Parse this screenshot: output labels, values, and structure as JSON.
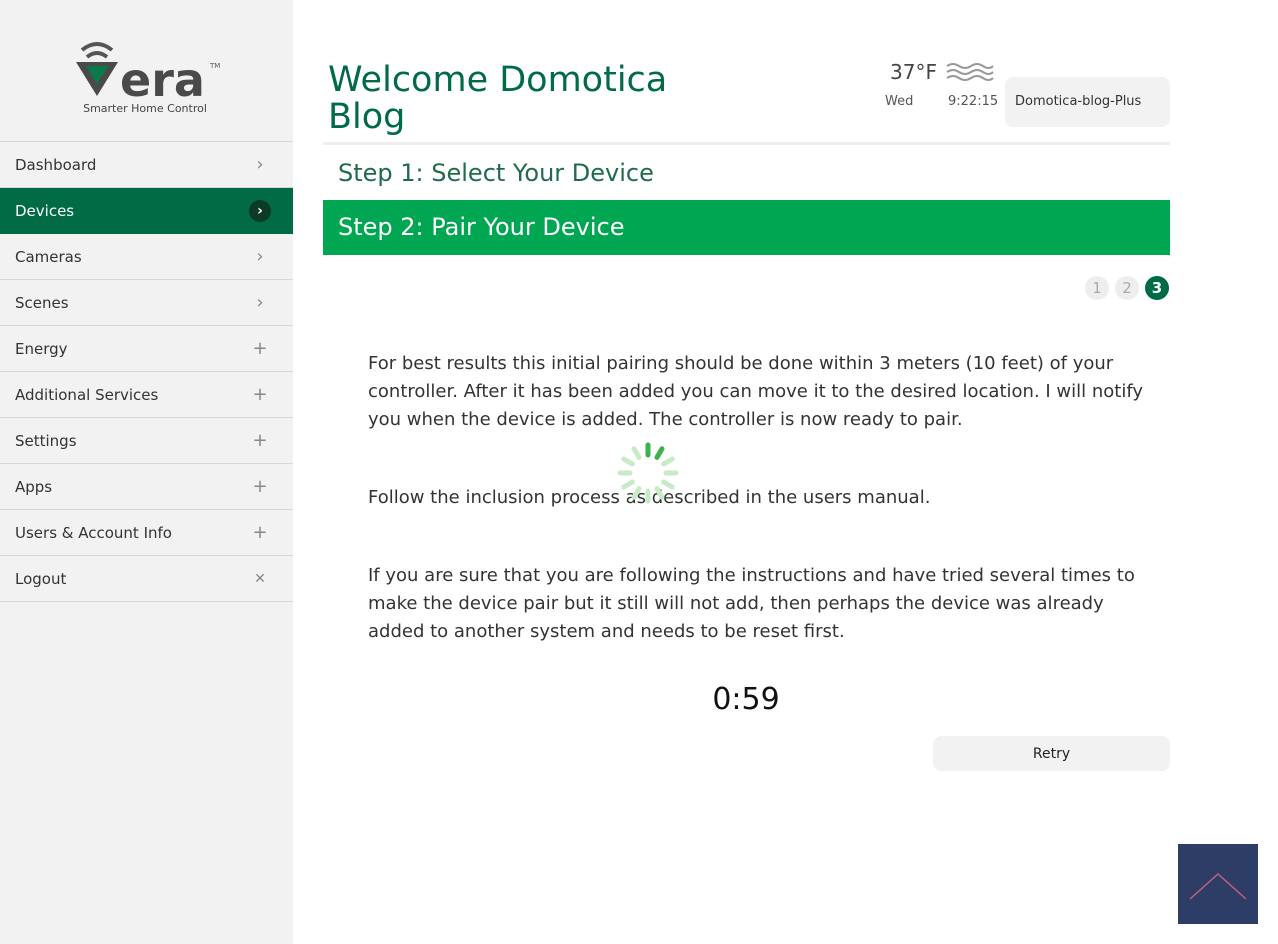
{
  "brand": {
    "logo_text": "vera",
    "tagline": "Smarter Home Control"
  },
  "sidebar": {
    "items": [
      {
        "label": "Dashboard",
        "icon": "chevron-right-icon",
        "glyph": "›"
      },
      {
        "label": "Devices",
        "icon": "chevron-right-icon",
        "glyph": "›"
      },
      {
        "label": "Cameras",
        "icon": "chevron-right-icon",
        "glyph": "›"
      },
      {
        "label": "Scenes",
        "icon": "chevron-right-icon",
        "glyph": "›"
      },
      {
        "label": "Energy",
        "icon": "plus-icon",
        "glyph": "+"
      },
      {
        "label": "Additional Services",
        "icon": "plus-icon",
        "glyph": "+"
      },
      {
        "label": "Settings",
        "icon": "plus-icon",
        "glyph": "+"
      },
      {
        "label": "Apps",
        "icon": "plus-icon",
        "glyph": "+"
      },
      {
        "label": "Users & Account Info",
        "icon": "plus-icon",
        "glyph": "+"
      },
      {
        "label": "Logout",
        "icon": "close-icon",
        "glyph": "✕"
      }
    ],
    "active": "Devices"
  },
  "header": {
    "title": "Welcome Domotica Blog",
    "temperature": "37°F",
    "day": "Wed",
    "time": "9:22:15",
    "unit_name": "Domotica-blog-Plus"
  },
  "wizard": {
    "step1": "Step 1: Select Your Device",
    "step2": "Step 2: Pair Your Device",
    "pages": [
      "1",
      "2",
      "3"
    ],
    "current_page": 3,
    "paragraphs": [
      "For best results this initial pairing should be done within 3 meters (10 feet) of your controller. After it has been added you can move it to the desired location. I will notify you when the device is added. The controller is now ready to pair.",
      "Follow the inclusion process as described in the users manual.",
      "If you are sure that you are following the instructions and have tried several times to make the device pair but it still will not add, then perhaps the device was already added to another system and needs to be reset first."
    ],
    "countdown": "0:59",
    "retry_label": "Retry"
  },
  "colors": {
    "primary": "#006b45",
    "accent": "#00a651"
  }
}
